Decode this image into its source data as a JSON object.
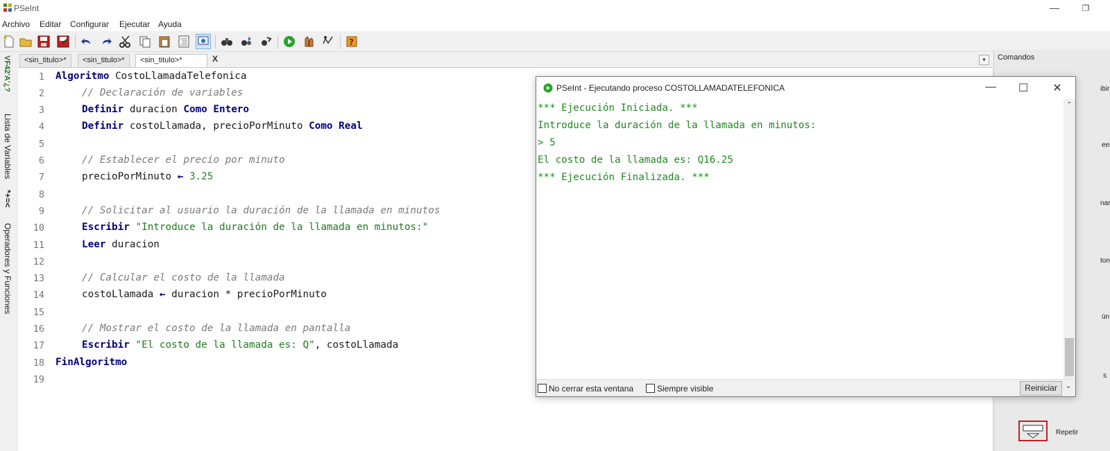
{
  "window": {
    "title": "PSeInt",
    "minimize": "—",
    "maximize": "❐"
  },
  "menu": [
    "Archivo",
    "Editar",
    "Configurar",
    "Ejecutar",
    "Ayuda"
  ],
  "left_panel": {
    "variables_label": "Lista de Variables",
    "operators_label": "Operadores y Funciones",
    "icons_text": "VF42'A'¿?",
    "ops_symbol": "*+=<"
  },
  "tabs": [
    {
      "label": "<sin_titulo>*"
    },
    {
      "label": "<sin_titulo>*"
    },
    {
      "label": "<sin_titulo>*"
    }
  ],
  "tab_close": "X",
  "editor": {
    "line_numbers": [
      "1",
      "2",
      "3",
      "4",
      "5",
      "6",
      "7",
      "8",
      "9",
      "10",
      "11",
      "12",
      "13",
      "14",
      "15",
      "16",
      "17",
      "18",
      "19"
    ],
    "l1_kw": "Algoritmo",
    "l1_rest": " CostoLlamadaTelefonica",
    "l2": "// Declaración de variables",
    "l3_kw1": "Definir",
    "l3_mid": " duracion ",
    "l3_kw2": "Como Entero",
    "l4_kw1": "Definir",
    "l4_mid": " costoLlamada, precioPorMinuto ",
    "l4_kw2": "Como Real",
    "l6": "// Establecer el precio por minuto",
    "l7_a": "precioPorMinuto ",
    "l7_arrow": "←",
    "l7_num": " 3.25",
    "l9": "// Solicitar al usuario la duración de la llamada en minutos",
    "l10_kw": "Escribir",
    "l10_str": " \"Introduce la duración de la llamada en minutos:\"",
    "l11_kw": "Leer",
    "l11_rest": " duracion",
    "l13": "// Calcular el costo de la llamada",
    "l14_a": "costoLlamada ",
    "l14_arrow": "←",
    "l14_b": " duracion * precioPorMinuto",
    "l16": "// Mostrar el costo de la llamada en pantalla",
    "l17_kw": "Escribir",
    "l17_str": " \"El costo de la llamada es: Q\"",
    "l17_rest": ", costoLlamada",
    "l18_kw": "FinAlgoritmo"
  },
  "right_panel": {
    "title": "Comandos",
    "frag1": "ibir",
    "frag2": "eer",
    "frag3": "nar",
    "frag4": "tonc",
    "frag5": "ún",
    "frag6": "s",
    "repeat_label": "Repetir"
  },
  "exec": {
    "title": "PSeInt - Ejecutando proceso COSTOLLAMADATELEFONICA",
    "min": "—",
    "max": "☐",
    "close": "✕",
    "lines": [
      "*** Ejecución Iniciada. ***",
      "Introduce la duración de la llamada en minutos:",
      "> 5",
      "El costo de la llamada es: Q16.25",
      "*** Ejecución Finalizada. ***"
    ],
    "cb1_label": "No cerrar esta ventana",
    "cb2_label": "Siempre visible",
    "restart_label": "Reiniciar",
    "restart_dd": "⌄"
  },
  "colors": {
    "keyword": "#00007a",
    "comment": "#7a7a7a",
    "string": "#1f7a1f",
    "console_text": "#1e8a1e"
  }
}
